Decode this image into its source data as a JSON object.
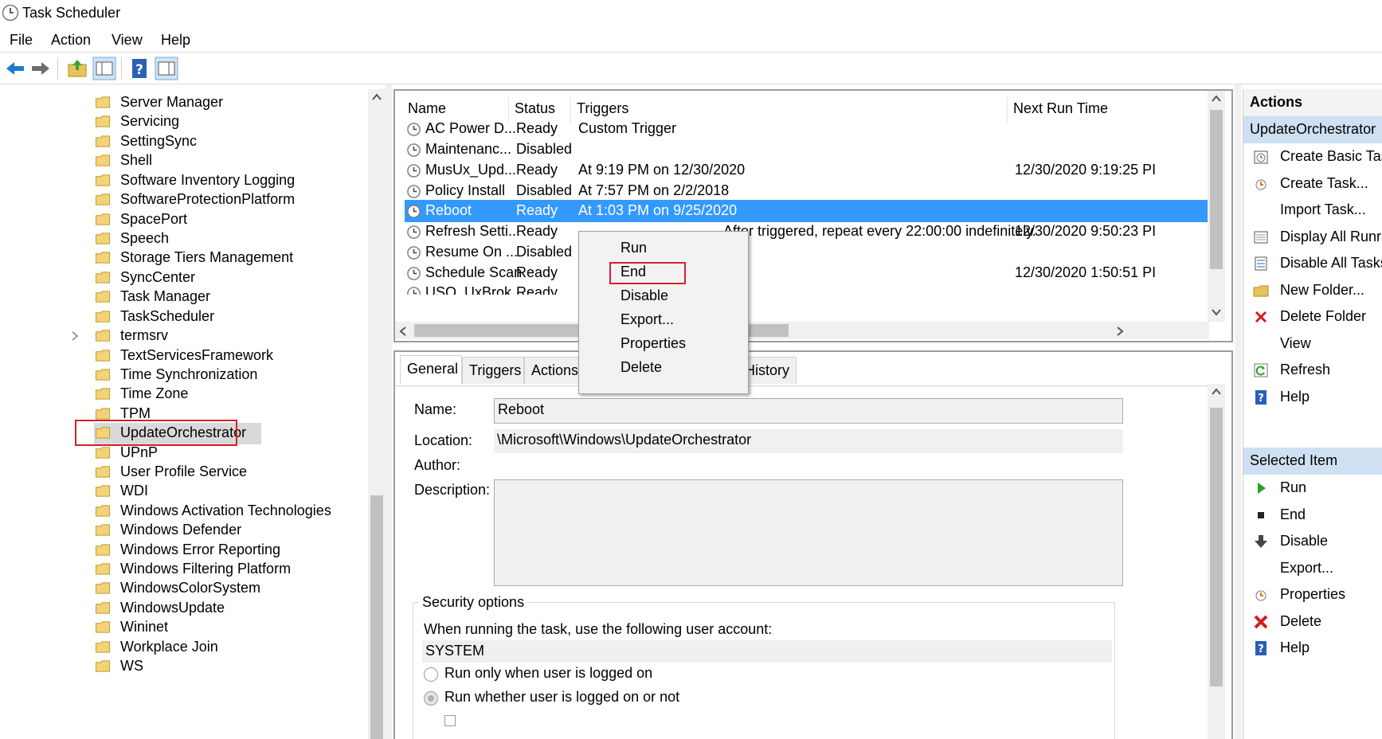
{
  "window": {
    "title": "Task Scheduler"
  },
  "menu": {
    "items": [
      "File",
      "Action",
      "View",
      "Help"
    ]
  },
  "toolbar": {
    "buttons": [
      "back-icon",
      "forward-icon",
      "up-folder-icon",
      "show-hide-console-tree-icon",
      "help-icon",
      "show-hide-action-pane-icon"
    ]
  },
  "tree": {
    "items": [
      "Server Manager",
      "Servicing",
      "SettingSync",
      "Shell",
      "Software Inventory Logging",
      "SoftwareProtectionPlatform",
      "SpacePort",
      "Speech",
      "Storage Tiers Management",
      "SyncCenter",
      "Task Manager",
      "TaskScheduler",
      "termsrv",
      "TextServicesFramework",
      "Time Synchronization",
      "Time Zone",
      "TPM",
      "UpdateOrchestrator",
      "UPnP",
      "User Profile Service",
      "WDI",
      "Windows Activation Technologies",
      "Windows Defender",
      "Windows Error Reporting",
      "Windows Filtering Platform",
      "WindowsColorSystem",
      "WindowsUpdate",
      "Wininet",
      "Workplace Join",
      "WS"
    ],
    "selected": "UpdateOrchestrator"
  },
  "tasklist": {
    "columns": [
      "Name",
      "Status",
      "Triggers",
      "Next Run Time"
    ],
    "rows": [
      {
        "name": "AC Power D...",
        "status": "Ready",
        "triggers": "Custom Trigger",
        "next": ""
      },
      {
        "name": "Maintenanc...",
        "status": "Disabled",
        "triggers": "",
        "next": ""
      },
      {
        "name": "MusUx_Upd...",
        "status": "Ready",
        "triggers": "At 9:19 PM on 12/30/2020",
        "next": "12/30/2020 9:19:25 PI"
      },
      {
        "name": "Policy Install",
        "status": "Disabled",
        "triggers": "At 7:57 PM on 2/2/2018",
        "next": ""
      },
      {
        "name": "Reboot",
        "status": "Ready",
        "triggers": "At 1:03 PM on 9/25/2020",
        "next": ""
      },
      {
        "name": "Refresh Setti...",
        "status": "Ready",
        "triggers": "After triggered, repeat every 22:00:00 indefinitely.",
        "next": "12/30/2020 9:50:23 PI"
      },
      {
        "name": "Resume On ...",
        "status": "Disabled",
        "triggers": "",
        "next": ""
      },
      {
        "name": "Schedule Scan",
        "status": "Ready",
        "triggers": "",
        "next": "12/30/2020 1:50:51 PI"
      },
      {
        "name": "USO_UxBrok...",
        "status": "Ready",
        "triggers": "",
        "next": ""
      }
    ],
    "selected": "Reboot"
  },
  "context_menu": {
    "items": [
      "Run",
      "End",
      "Disable",
      "Export...",
      "Properties",
      "Delete"
    ],
    "highlighted": "Disable"
  },
  "details": {
    "tabs": [
      "General",
      "Triggers",
      "Actions",
      "History"
    ],
    "active_tab": "General",
    "name_label": "Name:",
    "name_value": "Reboot",
    "location_label": "Location:",
    "location_value": "\\Microsoft\\Windows\\UpdateOrchestrator",
    "author_label": "Author:",
    "description_label": "Description:",
    "security_title": "Security options",
    "security_text": "When running the task, use the following user account:",
    "account": "SYSTEM",
    "radio1": "Run only when user is logged on",
    "radio2": "Run whether user is logged on or not"
  },
  "actions": {
    "header": "Actions",
    "folder_header": "UpdateOrchestrator",
    "folder_items": [
      {
        "label": "Create Basic Tas",
        "icon": "create-basic-task-icon"
      },
      {
        "label": "Create Task...",
        "icon": "create-task-icon"
      },
      {
        "label": "Import Task...",
        "icon": ""
      },
      {
        "label": "Display All Runr",
        "icon": "display-running-tasks-icon"
      },
      {
        "label": "Disable All Tasks",
        "icon": "disable-all-tasks-icon"
      },
      {
        "label": "New Folder...",
        "icon": "new-folder-icon"
      },
      {
        "label": "Delete Folder",
        "icon": "delete-folder-icon"
      },
      {
        "label": "View",
        "icon": ""
      },
      {
        "label": "Refresh",
        "icon": "refresh-icon"
      },
      {
        "label": "Help",
        "icon": "help-icon"
      }
    ],
    "selected_header": "Selected Item",
    "selected_items": [
      {
        "label": "Run",
        "icon": "run-icon"
      },
      {
        "label": "End",
        "icon": "end-icon"
      },
      {
        "label": "Disable",
        "icon": "disable-icon"
      },
      {
        "label": "Export...",
        "icon": ""
      },
      {
        "label": "Properties",
        "icon": "properties-icon"
      },
      {
        "label": "Delete",
        "icon": "delete-icon"
      },
      {
        "label": "Help",
        "icon": "help-icon"
      }
    ]
  },
  "colors": {
    "selection": "#3399ff",
    "highlight_box": "#d6212f",
    "action_subheader": "#cfe0f3"
  }
}
